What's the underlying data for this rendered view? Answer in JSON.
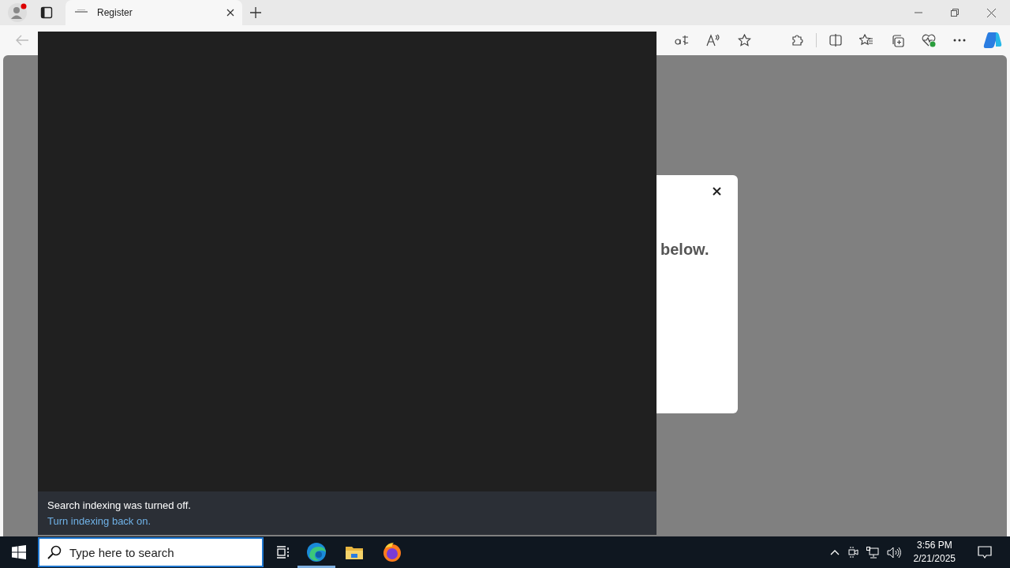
{
  "browser": {
    "tab": {
      "title": "Register"
    }
  },
  "dialog": {
    "text_fragment": "below."
  },
  "search_panel": {
    "message": "Search indexing was turned off.",
    "link": "Turn indexing back on."
  },
  "taskbar": {
    "search": {
      "placeholder": "Type here to search"
    },
    "apps": [
      {
        "kind": "edge",
        "running": true
      },
      {
        "kind": "explorer",
        "running": false
      },
      {
        "kind": "firefox",
        "running": false
      }
    ],
    "clock": {
      "time": "3:56 PM",
      "date": "2/21/2025"
    }
  }
}
